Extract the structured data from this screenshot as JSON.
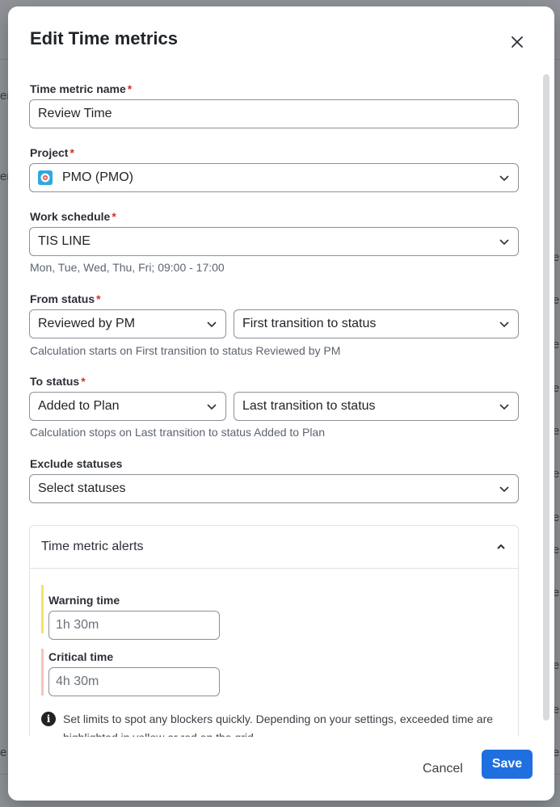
{
  "background": {
    "fragments": [
      "en",
      "en",
      "e",
      "e",
      "e",
      "e",
      "e",
      "e",
      "e",
      "e",
      "e",
      "e",
      "e",
      "e",
      "e"
    ]
  },
  "dialog": {
    "title": "Edit Time metrics",
    "close_icon": "close-icon",
    "required_marker": "*",
    "fields": {
      "name": {
        "label": "Time metric name",
        "value": "Review Time"
      },
      "project": {
        "label": "Project",
        "value": "PMO (PMO)",
        "icon": "project-avatar-icon"
      },
      "schedule": {
        "label": "Work schedule",
        "value": "TIS LINE",
        "hint": "Mon, Tue, Wed, Thu, Fri; 09:00 - 17:00"
      },
      "from_status": {
        "label": "From status",
        "status_value": "Reviewed by PM",
        "transition_value": "First transition to status",
        "hint": "Calculation starts on First transition to status Reviewed by PM"
      },
      "to_status": {
        "label": "To status",
        "status_value": "Added to Plan",
        "transition_value": "Last transition to status",
        "hint": "Calculation stops on Last transition to status Added to Plan"
      },
      "exclude": {
        "label": "Exclude statuses",
        "placeholder": "Select statuses"
      }
    },
    "alerts": {
      "title": "Time metric alerts",
      "warning": {
        "label": "Warning time",
        "placeholder": "1h 30m",
        "color": "#f5e26a"
      },
      "critical": {
        "label": "Critical time",
        "placeholder": "4h 30m",
        "color": "#f7c2bd"
      },
      "info": "Set limits to spot any blockers quickly. Depending on your settings, exceeded time are highlighted in yellow or red on the grid."
    },
    "footer": {
      "cancel": "Cancel",
      "save": "Save"
    },
    "colors": {
      "primary": "#1f6fe0",
      "required": "#c9372c"
    }
  }
}
